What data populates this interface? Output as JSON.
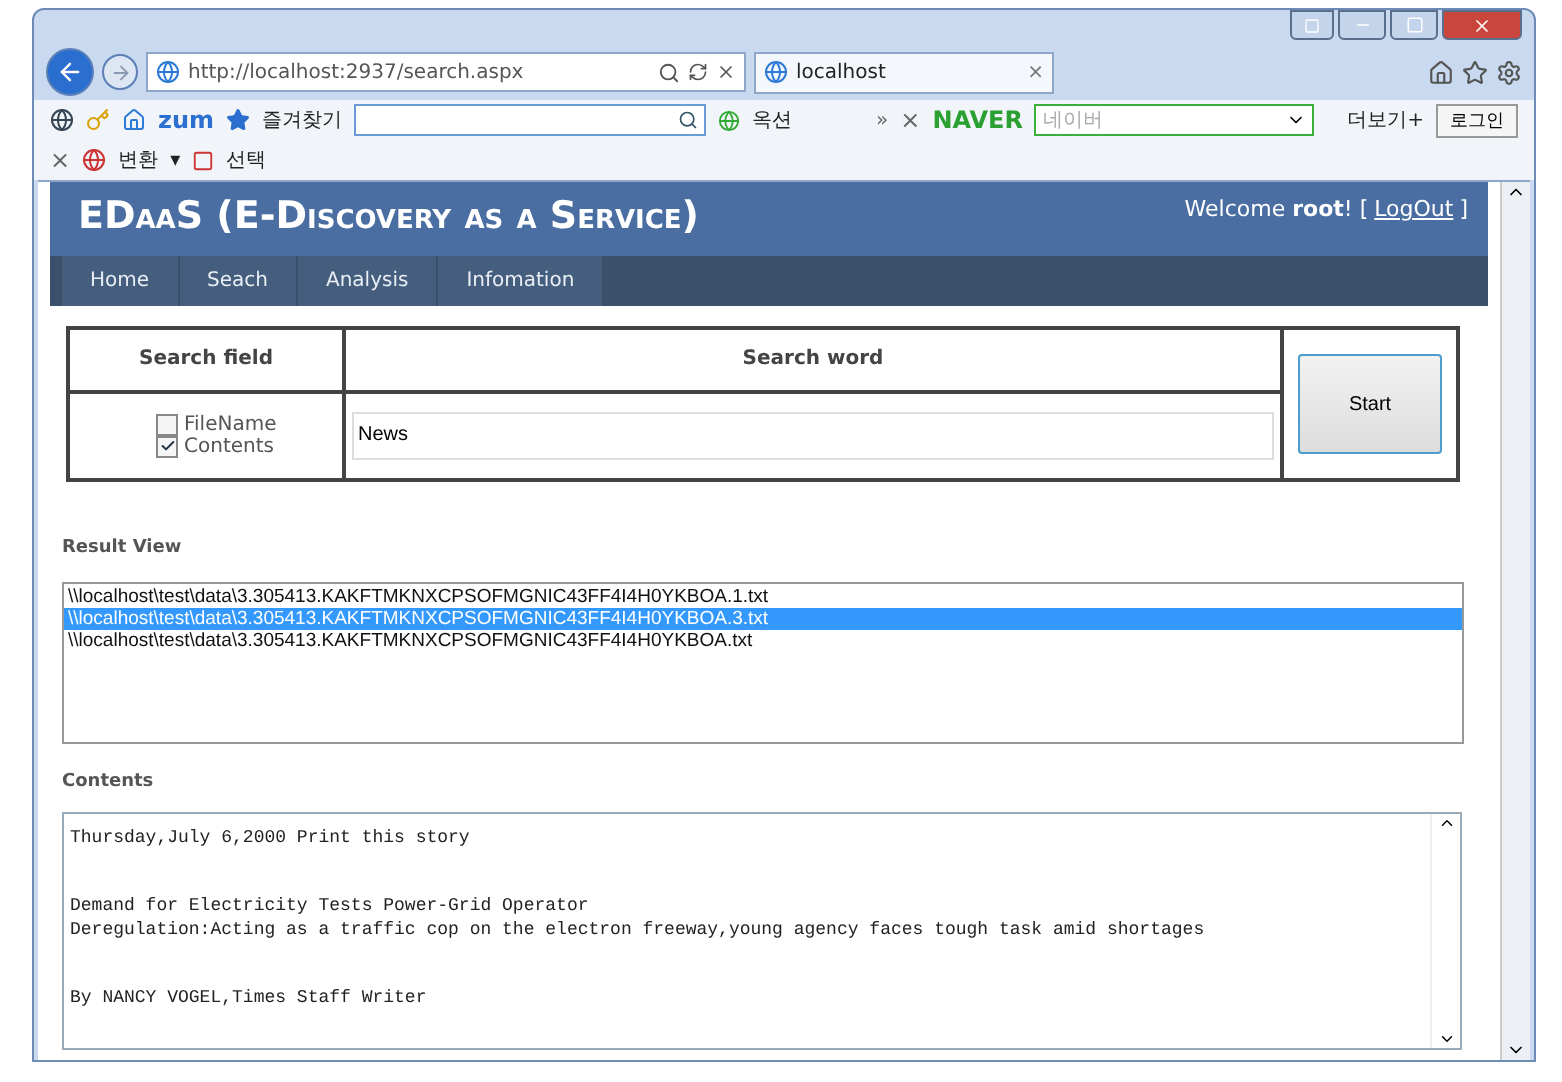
{
  "browser": {
    "address": "http://localhost:2937/search.aspx",
    "tab": {
      "label": "localhost",
      "close": "×"
    },
    "toolbar": {
      "zum": "zum",
      "favorites": "즐겨찾기",
      "auction": "옥션",
      "more_arrows": "»",
      "close": "×",
      "naver": "NAVER",
      "naver_placeholder": "네이버",
      "more": "더보기+",
      "login": "로그인"
    },
    "toolbar2": {
      "close": "×",
      "convert": "변환",
      "caret": "▾",
      "select": "선택"
    }
  },
  "page": {
    "title": "EDaaS (E-Discovery as a Service)",
    "welcome": "Welcome **root**! [",
    "logout": "LogOut",
    "welcome_end": "]",
    "nav": [
      {
        "label": "Home"
      },
      {
        "label": "Seach"
      },
      {
        "label": "Analysis"
      },
      {
        "label": "Infomation"
      }
    ],
    "search": {
      "field_header": "Search field",
      "word_header": "Search word",
      "fields": [
        {
          "label": "FileName",
          "checked": false
        },
        {
          "label": "Contents",
          "checked": true
        }
      ],
      "word": "News",
      "start": "Start"
    },
    "result_label": "Result View",
    "results": [
      {
        "path": "\\\\localhost\\test\\data\\3.305413.KAKFTMKNXCPSOFMGNIC43FF4I4H0YKBOA.1.txt",
        "selected": false
      },
      {
        "path": "\\\\localhost\\test\\data\\3.305413.KAKFTMKNXCPSOFMGNIC43FF4I4H0YKBOA.3.txt",
        "selected": true
      },
      {
        "path": "\\\\localhost\\test\\data\\3.305413.KAKFTMKNXCPSOFMGNIC43FF4I4H0YKBOA.txt",
        "selected": false
      }
    ],
    "contents_label": "Contents",
    "contents": [
      "Thursday,July 6,2000 Print this story",
      "Demand for Electricity Tests Power-Grid Operator\nDeregulation:Acting as a traffic cop on the electron freeway,young agency faces tough task amid shortages",
      "By NANCY VOGEL,Times Staff Writer"
    ]
  }
}
